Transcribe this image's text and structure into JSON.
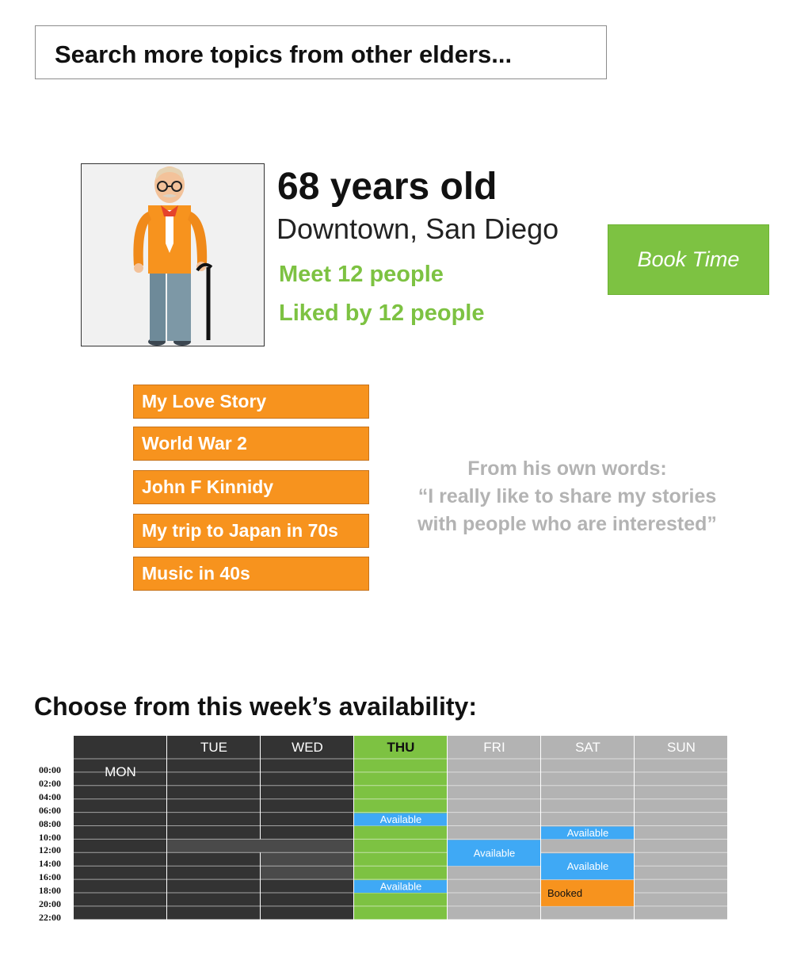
{
  "search": {
    "placeholder": "Search more topics from other elders..."
  },
  "profile": {
    "age": "68 years old",
    "location": "Downtown, San Diego",
    "meet": "Meet 12 people",
    "liked": "Liked by 12 people",
    "book_label": "Book Time",
    "avatar_icon": "elder-man-with-cane-icon"
  },
  "topics": [
    "My Love Story",
    "World War 2",
    "John F Kinnidy",
    "My trip to Japan in 70s",
    "Music in 40s"
  ],
  "quote": {
    "line1": "From his own words:",
    "line2": "“I really like to share my stories",
    "line3": "with people who are interested”"
  },
  "availability": {
    "heading": "Choose from this week’s availability:",
    "days": [
      "MON",
      "TUE",
      "WED",
      "THU",
      "FRI",
      "SAT",
      "SUN"
    ],
    "times": [
      "00:00",
      "02:00",
      "04:00",
      "06:00",
      "08:00",
      "10:00",
      "12:00",
      "14:00",
      "16:00",
      "18:00",
      "20:00",
      "22:00"
    ],
    "slots": [
      {
        "day": "THU",
        "start": "08:00",
        "end": "10:00",
        "label": "Available",
        "status": "available"
      },
      {
        "day": "THU",
        "start": "18:00",
        "end": "20:00",
        "label": "Available",
        "status": "available"
      },
      {
        "day": "FRI",
        "start": "12:00",
        "end": "16:00",
        "label": "Available",
        "status": "available"
      },
      {
        "day": "SAT",
        "start": "10:00",
        "end": "12:00",
        "label": "Available",
        "status": "available"
      },
      {
        "day": "SAT",
        "start": "14:00",
        "end": "18:00",
        "label": "Available",
        "status": "available"
      },
      {
        "day": "SAT",
        "start": "18:00",
        "end": "22:00",
        "label": "Booked",
        "status": "booked"
      }
    ],
    "colors": {
      "past": "#333333",
      "today": "#7dc242",
      "future": "#b3b3b3",
      "available": "#3fa9f5",
      "booked": "#f7931e"
    }
  }
}
